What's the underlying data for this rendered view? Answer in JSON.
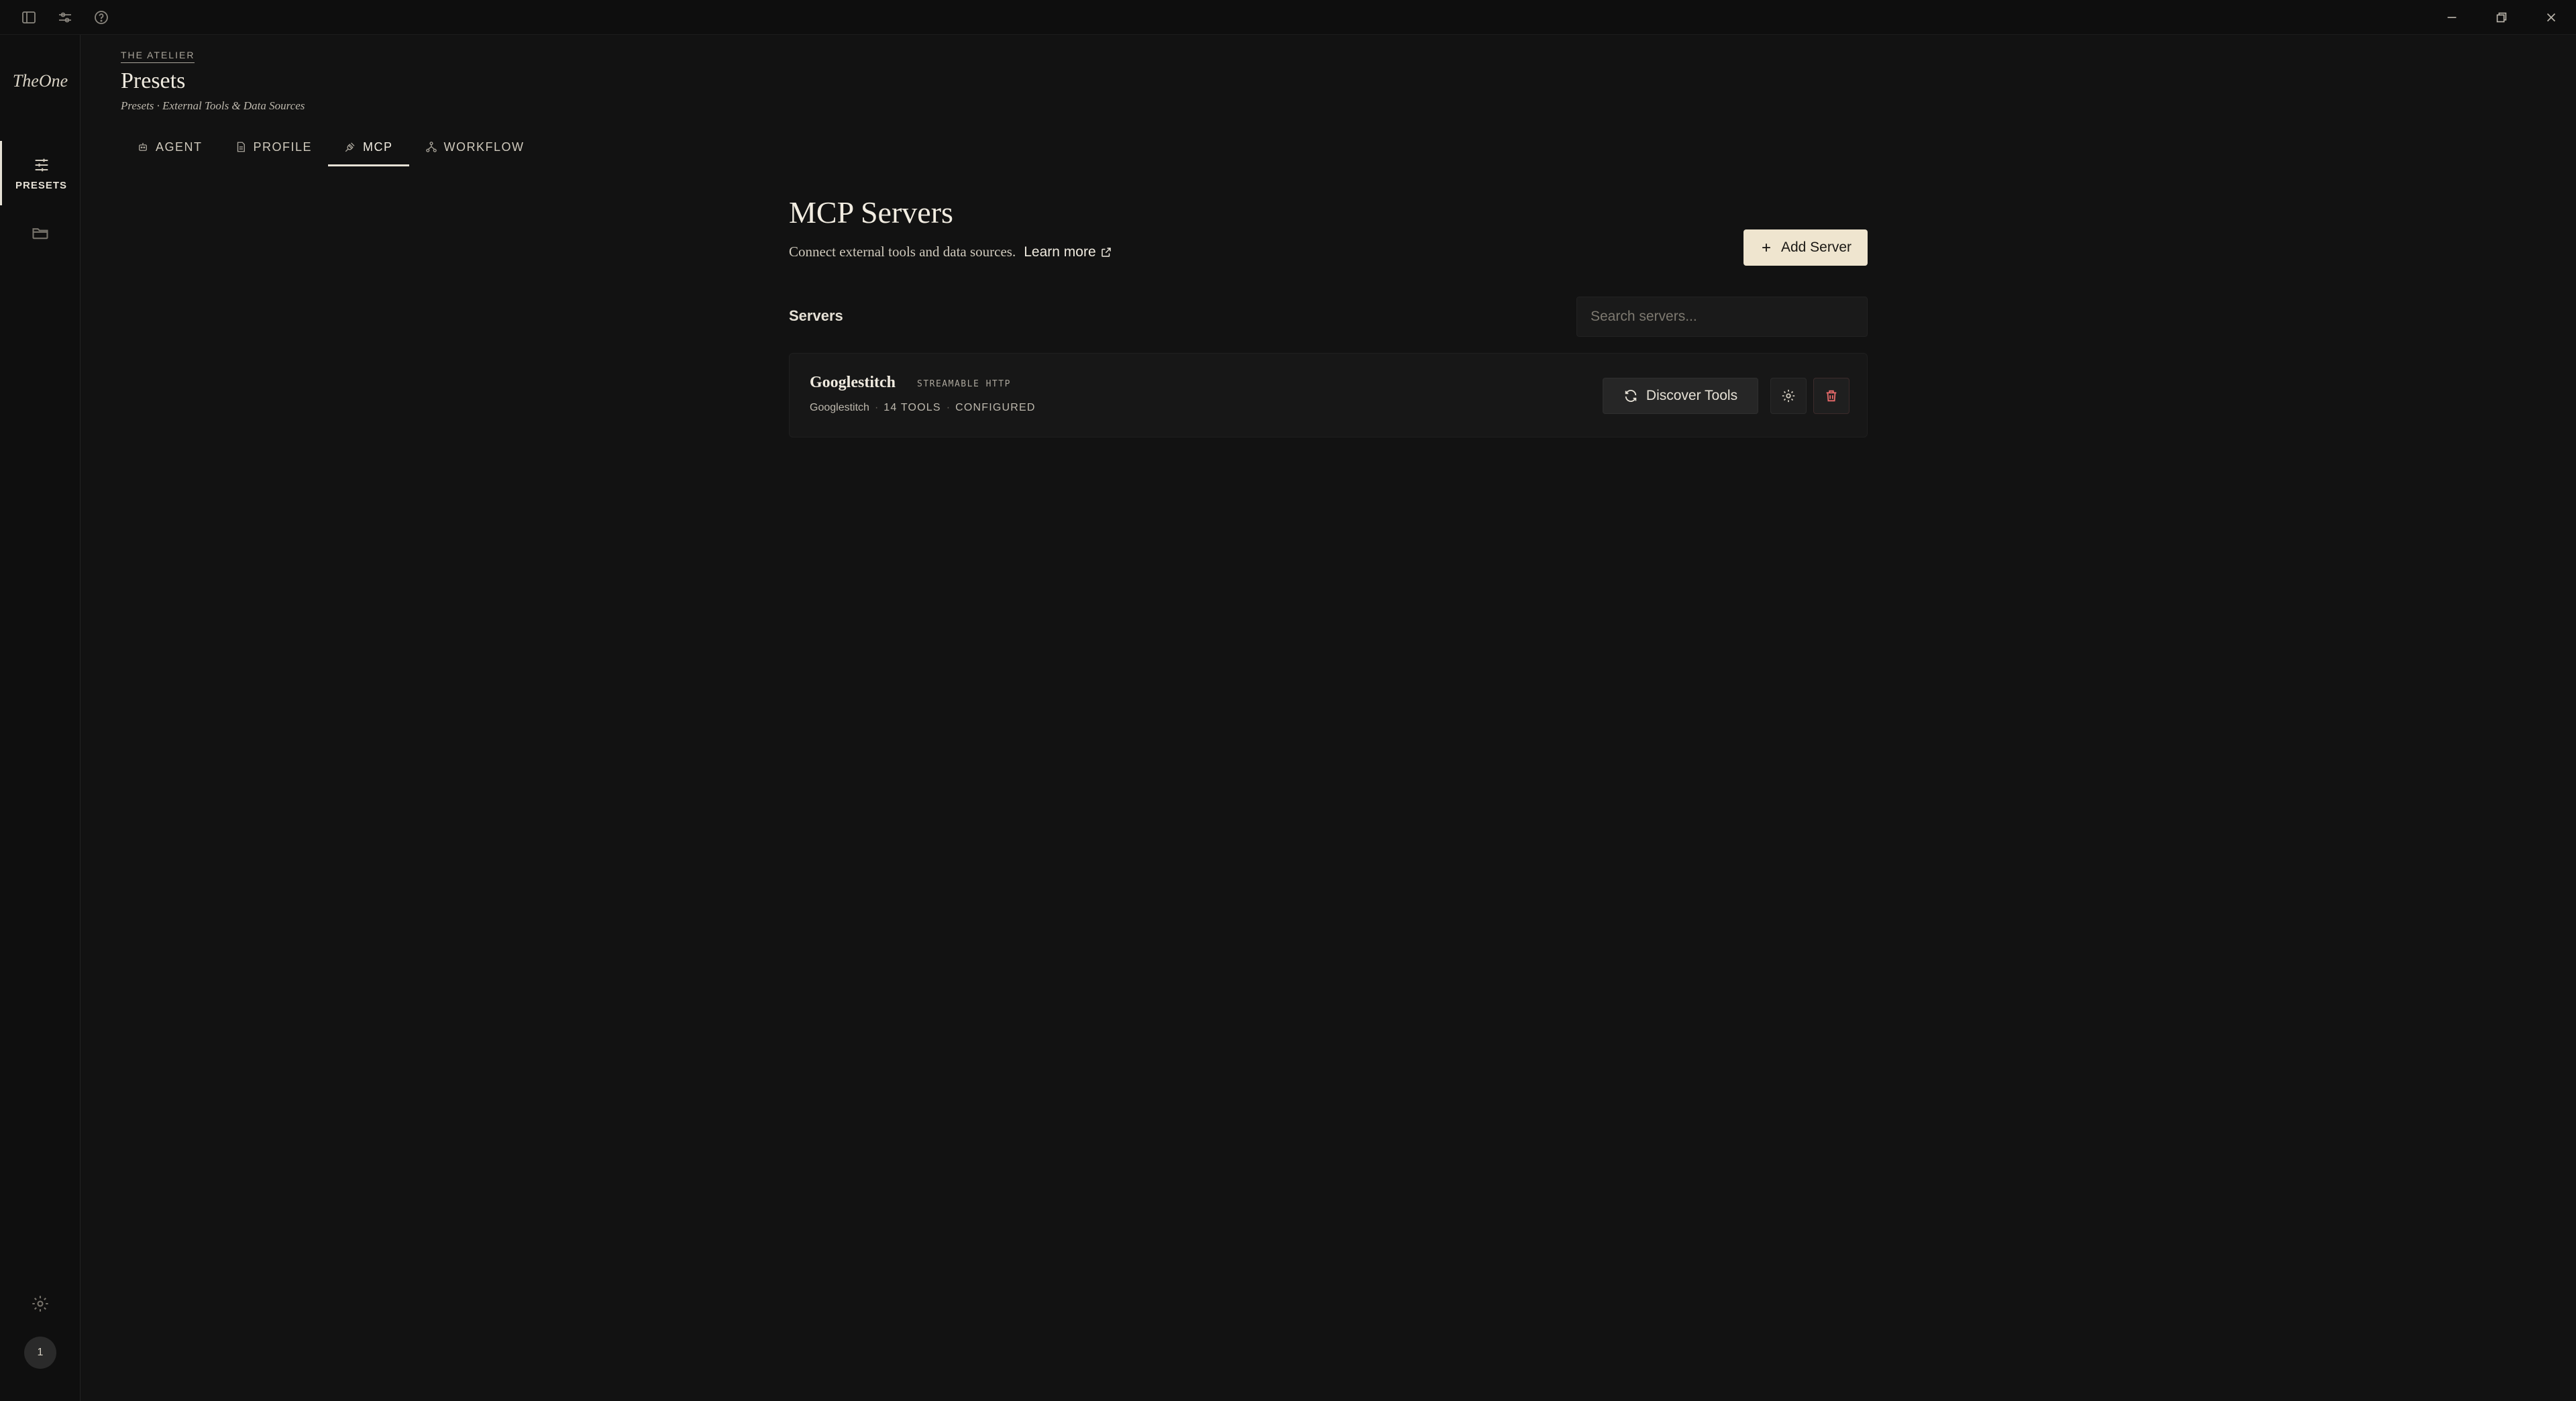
{
  "app": {
    "logo": "TheOne"
  },
  "rail": {
    "presets_label": "PRESETS",
    "avatar_initial": "1"
  },
  "header": {
    "eyebrow": "THE ATELIER",
    "title": "Presets",
    "subtitle": "Presets · External Tools & Data Sources"
  },
  "tabs": [
    {
      "label": "AGENT",
      "icon": "robot-icon"
    },
    {
      "label": "PROFILE",
      "icon": "document-icon"
    },
    {
      "label": "MCP",
      "icon": "plug-icon",
      "active": true
    },
    {
      "label": "WORKFLOW",
      "icon": "workflow-icon"
    }
  ],
  "main": {
    "title": "MCP Servers",
    "description": "Connect external tools and data sources.",
    "learn_more": "Learn more",
    "add_server": "Add Server",
    "servers_label": "Servers",
    "search_placeholder": "Search servers..."
  },
  "servers": [
    {
      "name": "Googlestitch",
      "transport": "STREAMABLE HTTP",
      "id": "Googlestitch",
      "tools": "14 TOOLS",
      "status": "CONFIGURED",
      "discover_label": "Discover Tools"
    }
  ],
  "colors": {
    "background": "#121212",
    "accent_button": "#efe5cf",
    "danger": "#e86a6a"
  }
}
